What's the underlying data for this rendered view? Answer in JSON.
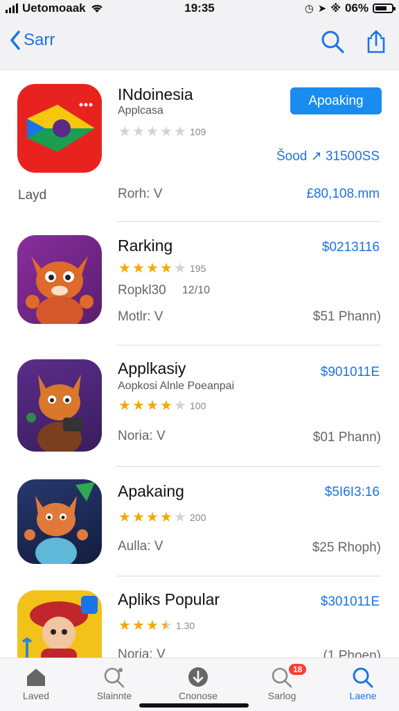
{
  "status_bar": {
    "carrier": "Uetomoaak",
    "time": "19:35",
    "battery": "06%"
  },
  "nav": {
    "back_label": "Sarr",
    "icons": [
      "search-icon",
      "share-icon"
    ]
  },
  "apps": [
    {
      "name": "INdoinesia",
      "subtitle": "Applcasa",
      "stars": 5,
      "stars_filled": 0,
      "rating_count": "109",
      "button_label": "Apoaking",
      "price_small": "Šood ↗ 31500SS",
      "side_label": "Layd",
      "meta": "Rorh: V",
      "price_right": "£80,108.mm",
      "icon_colors": [
        "#e8231f",
        "#f5c80e",
        "#1a9e4f",
        "#1a73e8"
      ]
    },
    {
      "name": "Rarking",
      "stars_filled": 4,
      "rating_count": "195",
      "meta_line": "Ropkl30",
      "meta_line2": "12/10",
      "meta": "Motlr: V",
      "price_right": "$0213116",
      "price_gray": "$51 Phann)",
      "icon_colors": [
        "#7b2f8f",
        "#e06a2a"
      ]
    },
    {
      "name": "Applkasiy",
      "subtitle": "Aopkosi Alnle Poeanpai",
      "stars_filled": 4,
      "rating_count": "100",
      "meta": "Noria: V",
      "price_right": "$901011E",
      "price_gray": "$01 Phann)",
      "icon_colors": [
        "#4a2a7a",
        "#d9772a"
      ]
    },
    {
      "name": "Apakaing",
      "stars_filled": 4,
      "rating_count": "200",
      "meta": "Aulla: V",
      "price_right": "$5I6I3:16",
      "price_gray": "$25 Rhoph)",
      "icon_colors": [
        "#1d2a5c",
        "#2fa84f"
      ]
    },
    {
      "name": "Apliks Popular",
      "stars_filled": 3.5,
      "rating_count": "1.30",
      "meta": "Noria: V",
      "price_right": "$301011E",
      "price_gray": "(1 Phoen)",
      "icon_colors": [
        "#f2c21a",
        "#c0262c"
      ]
    }
  ],
  "tabs": [
    {
      "label": "Laved",
      "icon": "house-icon",
      "active": false
    },
    {
      "label": "Slainnte",
      "icon": "search-person-icon",
      "active": false
    },
    {
      "label": "Cnonose",
      "icon": "download-icon",
      "active": false
    },
    {
      "label": "Sarlog",
      "icon": "search-icon",
      "active": false,
      "badge": "18"
    },
    {
      "label": "Laene",
      "icon": "search-icon",
      "active": true
    }
  ]
}
